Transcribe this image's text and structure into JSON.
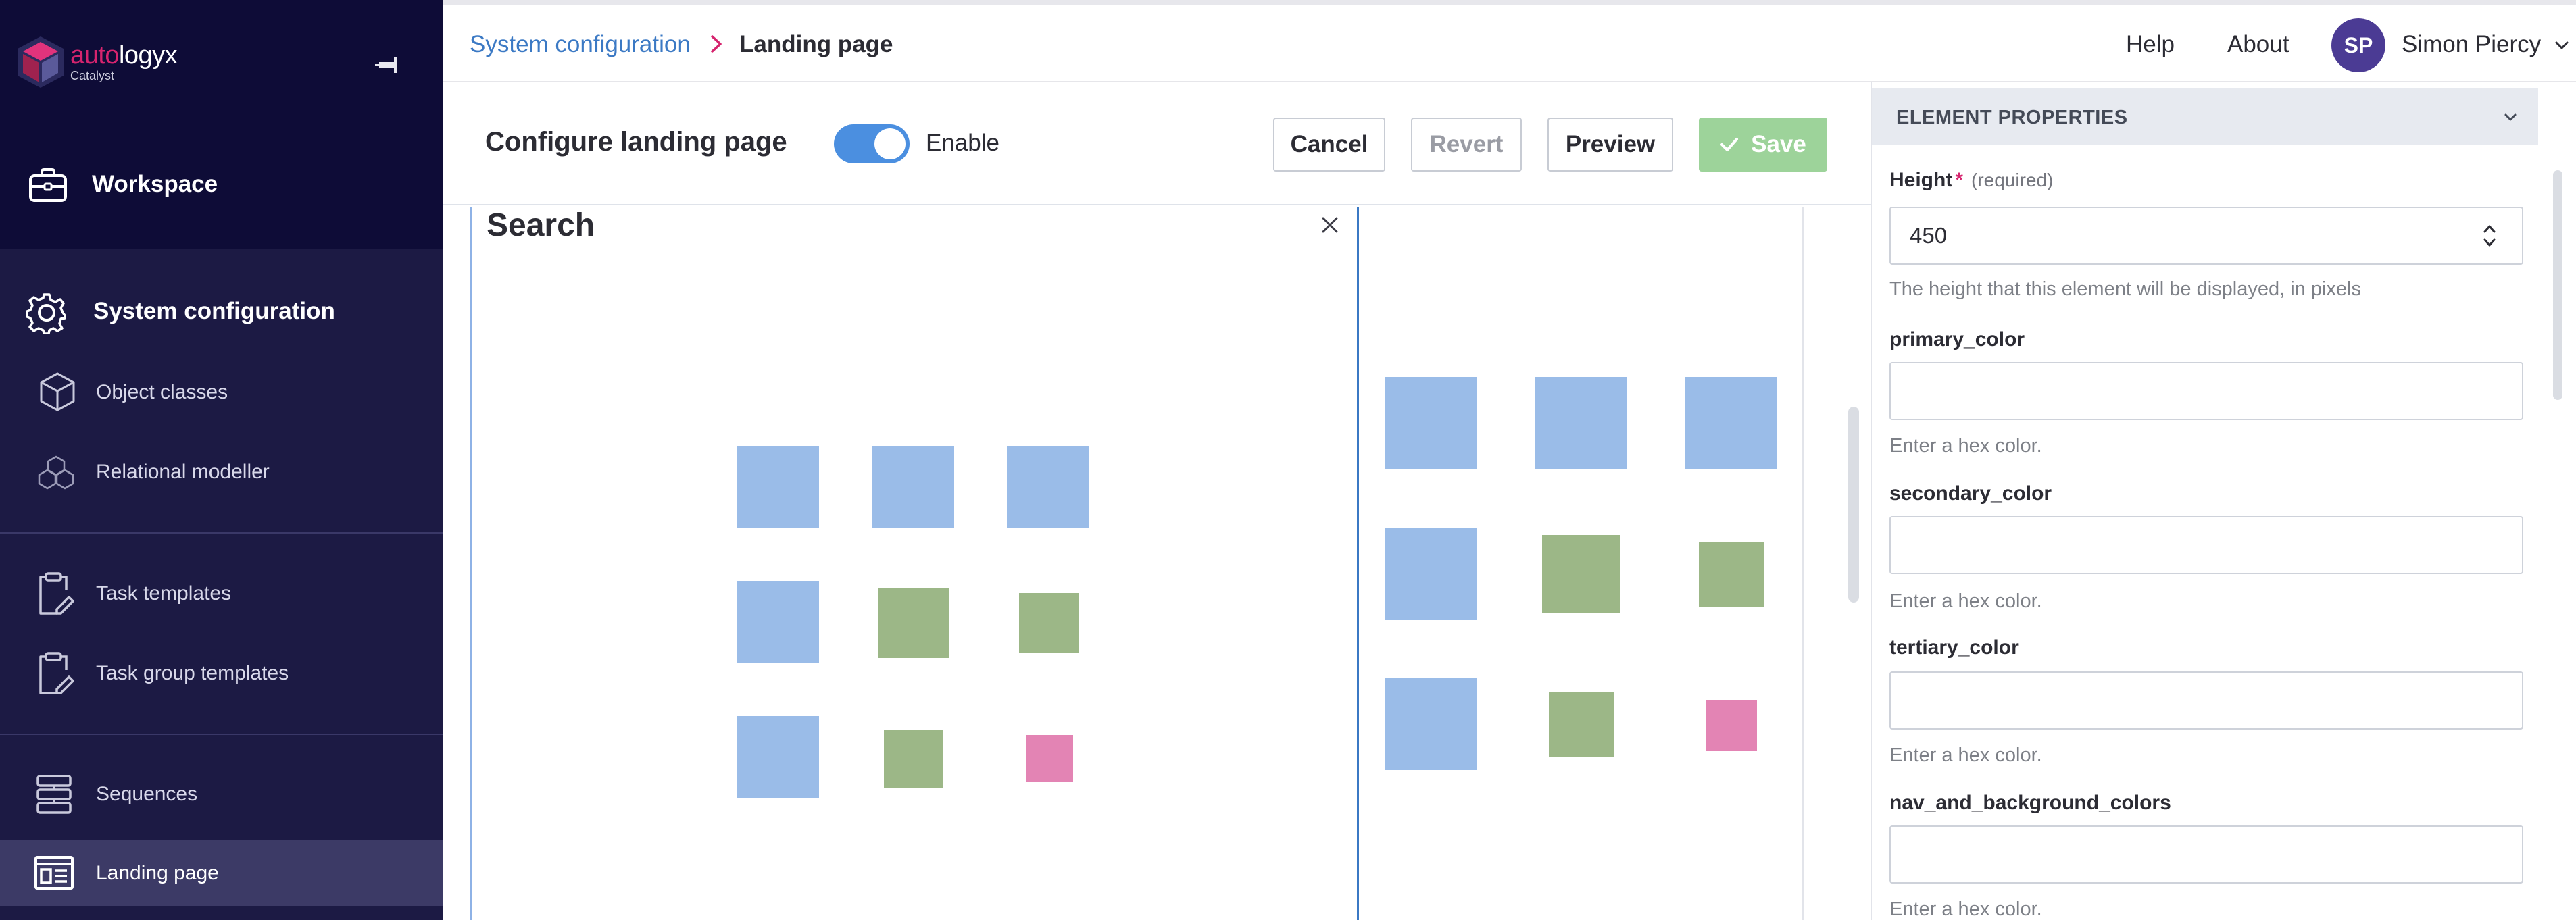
{
  "sidebar": {
    "logo": {
      "brand_accent": "auto",
      "brand_rest": "logyx",
      "sub": "Catalyst"
    },
    "workspace_label": "Workspace",
    "system_configuration_label": "System configuration",
    "items": [
      {
        "label": "Object classes",
        "icon": "cube-icon"
      },
      {
        "label": "Relational modeller",
        "icon": "cubes-icon"
      },
      {
        "label": "Task templates",
        "icon": "clipboard-edit-icon"
      },
      {
        "label": "Task group templates",
        "icon": "clipboard-edit-icon"
      },
      {
        "label": "Sequences",
        "icon": "sequence-icon"
      },
      {
        "label": "Landing page",
        "icon": "landing-page-icon",
        "active": true
      }
    ]
  },
  "header": {
    "breadcrumb": {
      "parent": "System configuration",
      "current": "Landing page"
    },
    "help": "Help",
    "about": "About",
    "user": {
      "initials": "SP",
      "name": "Simon Piercy"
    }
  },
  "config": {
    "title": "Configure landing page",
    "enable_label": "Enable",
    "enabled": true,
    "cancel": "Cancel",
    "revert": "Revert",
    "preview": "Preview",
    "save": "Save"
  },
  "canvas": {
    "widget_title": "Search"
  },
  "properties": {
    "title": "ELEMENT PROPERTIES",
    "height": {
      "label": "Height",
      "required_marker": "*",
      "required_text": "(required)",
      "value": "450",
      "help": "The height that this element will be displayed, in pixels"
    },
    "fields": [
      {
        "label": "primary_color",
        "value": "",
        "help": "Enter a hex color."
      },
      {
        "label": "secondary_color",
        "value": "",
        "help": "Enter a hex color."
      },
      {
        "label": "tertiary_color",
        "value": "",
        "help": "Enter a hex color."
      },
      {
        "label": "nav_and_background_colors",
        "value": "",
        "help": "Enter a hex color."
      }
    ]
  },
  "colors": {
    "sidebar_dark": "#0e0c37",
    "sidebar": "#1c1a44",
    "accent_blue": "#4b8fe0",
    "brand_pink": "#d6246e",
    "save_green": "#9dd39a",
    "shape_blue": "#9abce8",
    "shape_green": "#9cb787",
    "shape_pink": "#e384b4"
  }
}
